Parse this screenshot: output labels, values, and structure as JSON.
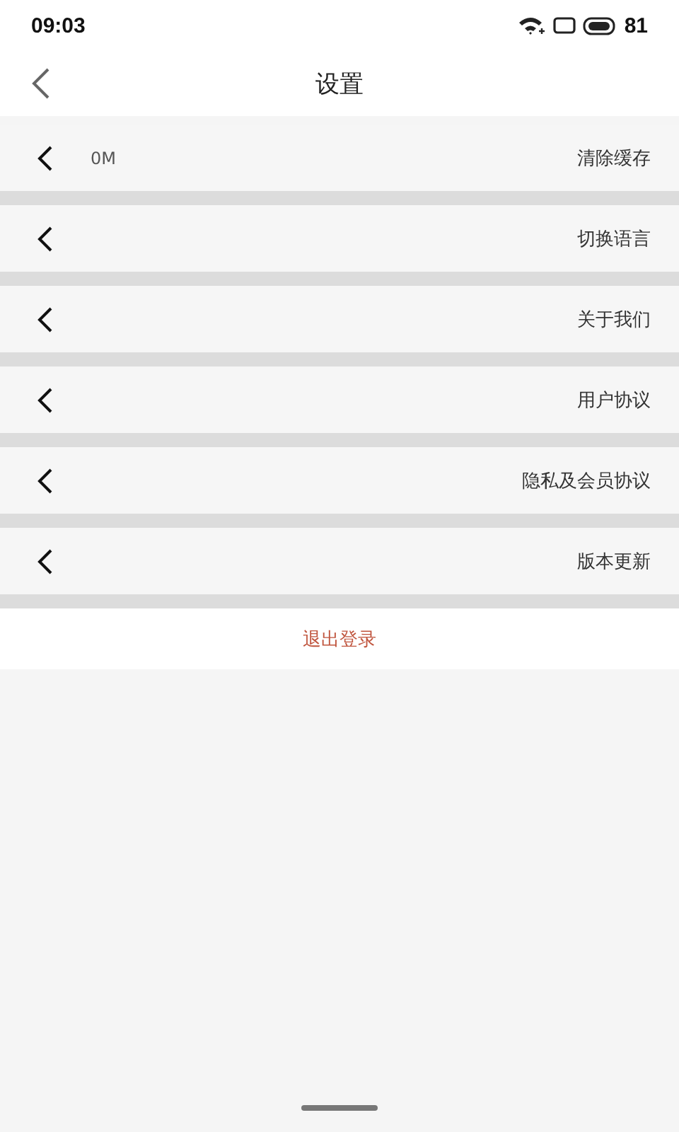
{
  "status_bar": {
    "time": "09:03",
    "battery": "81"
  },
  "header": {
    "title": "设置"
  },
  "items": [
    {
      "label": "清除缓存",
      "value": "0M"
    },
    {
      "label": "切换语言"
    },
    {
      "label": "关于我们"
    },
    {
      "label": "用户协议"
    },
    {
      "label": "隐私及会员协议"
    },
    {
      "label": "版本更新"
    }
  ],
  "logout": "退出登录"
}
